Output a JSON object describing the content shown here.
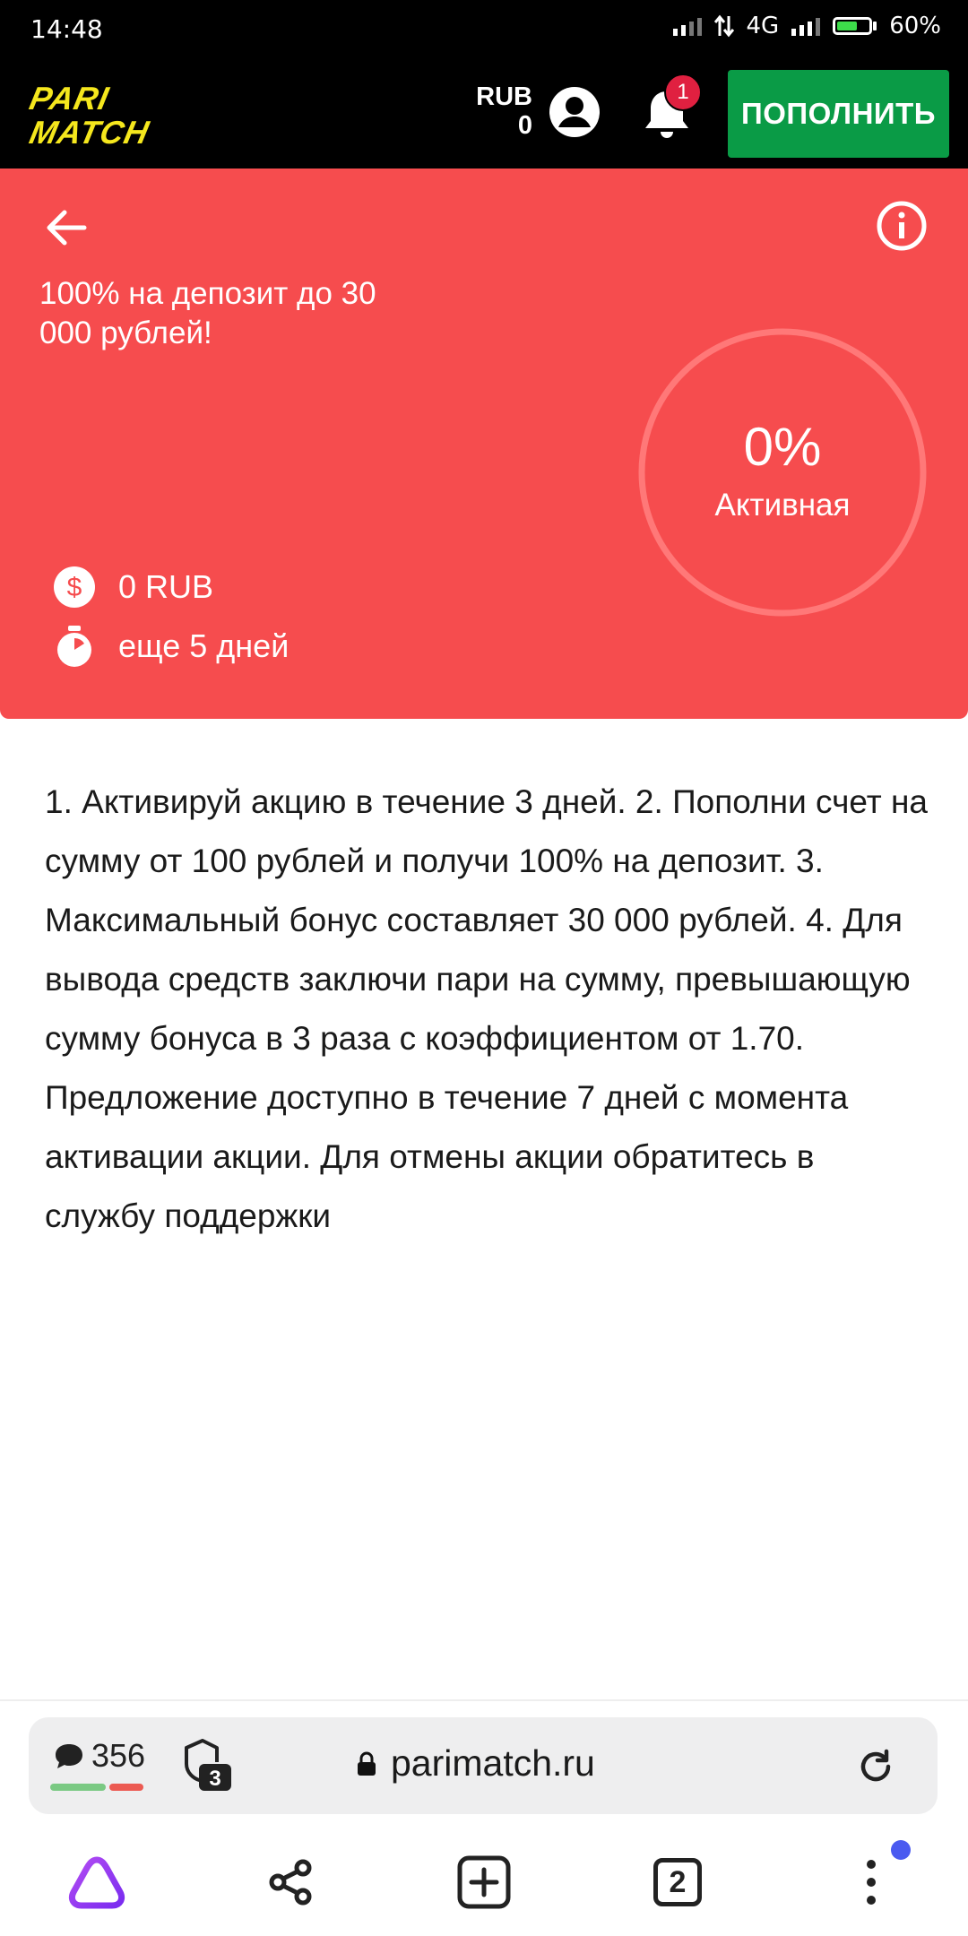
{
  "status_bar": {
    "time": "14:48",
    "network": "4G",
    "battery": "60%",
    "battery_level": 0.6
  },
  "header": {
    "logo_text": [
      "PARI",
      "MATCH"
    ],
    "currency": "RUB",
    "balance": "0",
    "notification_count": "1",
    "deposit_button": "ПОПОЛНИТЬ"
  },
  "promo": {
    "title": "100% на депозит до 30 000 рублей!",
    "progress_percent_text": "0%",
    "progress": 0,
    "status": "Активная",
    "amount": "0 RUB",
    "time_left": "еще 5 дней",
    "color": "#f64c4e"
  },
  "description": "1. Активируй акцию в течение 3 дней. 2. Пополни счет на сумму от 100 рублей и получи 100% на депозит. 3. Максимальный бонус составляет 30 000 рублей. 4. Для вывода средств заключи пари на сумму, превышающую сумму бонуса в 3 раза с коэффициентом от 1.70. Предложение доступно в течение 7 дней с момента активации акции. Для отмены акции обратитесь в службу поддержки",
  "browser": {
    "comments_count": "356",
    "shield_count": "3",
    "url": "parimatch.ru",
    "tabs_count": "2"
  }
}
